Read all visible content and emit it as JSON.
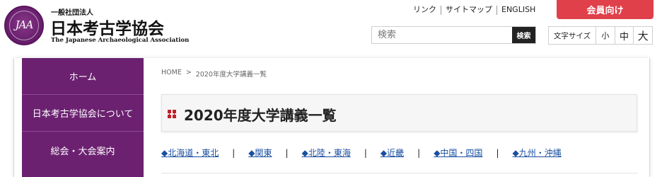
{
  "header": {
    "org_prefix": "一般社団法人",
    "org_name": "日本考古学協会",
    "org_name_en": "The Japanese Archaeological Association",
    "logo_monogram": "JAA",
    "util_links": [
      "リンク",
      "サイトマップ",
      "ENGLISH"
    ],
    "member_button": "会員向け",
    "search": {
      "placeholder": "検索",
      "button": "検索"
    },
    "font_size": {
      "label": "文字サイズ",
      "small": "小",
      "medium": "中",
      "large": "大"
    }
  },
  "sidebar": {
    "items": [
      {
        "label": "ホーム"
      },
      {
        "label": "日本考古学協会について"
      },
      {
        "label": "総会・大会案内"
      }
    ]
  },
  "breadcrumb": {
    "home": "HOME",
    "separator": ">",
    "current": "2020年度大学講義一覧"
  },
  "page": {
    "title": "2020年度大学講義一覧"
  },
  "regions": {
    "separator": "|",
    "items": [
      {
        "arrow": "◆",
        "label": "北海道・東北"
      },
      {
        "arrow": "◆",
        "label": "関東"
      },
      {
        "arrow": "◆",
        "label": "北陸・東海"
      },
      {
        "arrow": "◆",
        "label": "近畿"
      },
      {
        "arrow": "◆",
        "label": "中国・四国"
      },
      {
        "arrow": "◆",
        "label": "九州・沖縄"
      }
    ]
  },
  "colors": {
    "brand_purple": "#6b2170",
    "member_red": "#e0404a",
    "link_blue": "#1a4fa0",
    "title_icon_red": "#c0202a"
  }
}
